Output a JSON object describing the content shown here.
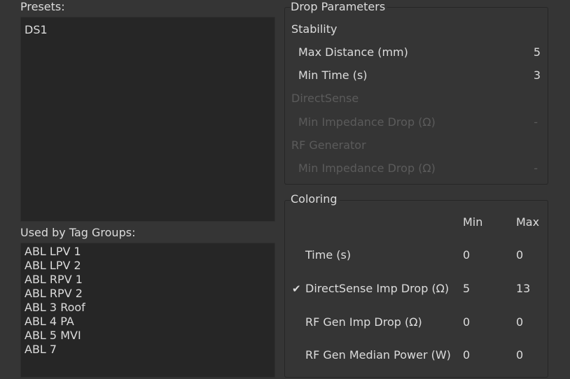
{
  "presets": {
    "label": "Presets:",
    "items": [
      "DS1"
    ]
  },
  "tag_groups": {
    "label": "Used by Tag Groups:",
    "items": [
      "ABL LPV 1",
      "ABL LPV 2",
      "ABL RPV 1",
      "ABL RPV 2",
      "ABL 3 Roof",
      "ABL 4 PA",
      "ABL 5 MVI",
      "ABL 7"
    ]
  },
  "drop_parameters": {
    "title": "Drop Parameters",
    "stability": {
      "heading": "Stability",
      "max_distance_label": "Max Distance  (mm)",
      "max_distance_value": "5",
      "min_time_label": "Min Time  (s)",
      "min_time_value": "3"
    },
    "directsense": {
      "heading": "DirectSense",
      "min_impedance_label": "Min Impedance Drop  (Ω)",
      "min_impedance_value": "-"
    },
    "rf_generator": {
      "heading": "RF Generator",
      "min_impedance_label": "Min Impedance Drop  (Ω)",
      "min_impedance_value": "-"
    }
  },
  "coloring": {
    "title": "Coloring",
    "col_min": "Min",
    "col_max": "Max",
    "rows": [
      {
        "label": "Time (s)",
        "min": "0",
        "max": "0",
        "checked": false
      },
      {
        "label": "DirectSense Imp Drop (Ω)",
        "min": "5",
        "max": "13",
        "checked": true
      },
      {
        "label": "RF Gen Imp Drop (Ω)",
        "min": "0",
        "max": "0",
        "checked": false
      },
      {
        "label": "RF Gen Median Power (W)",
        "min": "0",
        "max": "0",
        "checked": false
      }
    ],
    "check_glyph": "✔"
  },
  "colors": {
    "background": "#353535",
    "list_background": "#262626",
    "text": "#dcdcdc",
    "disabled_text": "#5b5b5b"
  }
}
